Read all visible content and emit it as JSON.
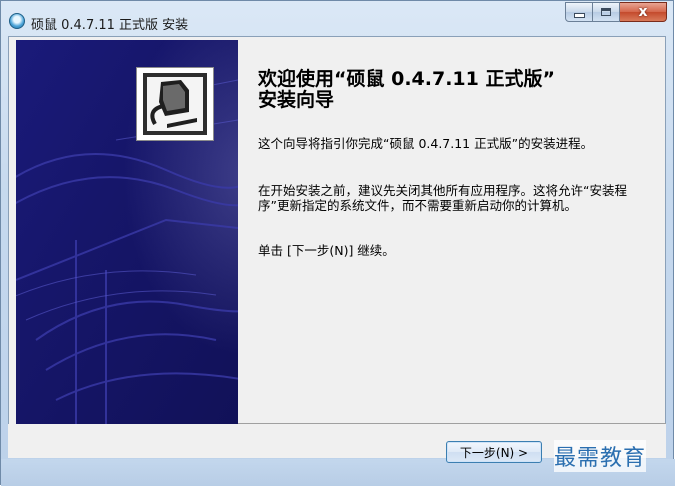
{
  "window": {
    "title": "硕鼠 0.4.7.11 正式版 安装",
    "minimize_icon": "minimize-icon",
    "maximize_icon": "maximize-icon",
    "close_icon": "close-icon",
    "close_glyph": "x"
  },
  "wizard": {
    "heading_line1": "欢迎使用“硕鼠 0.4.7.11 正式版”",
    "heading_line2": "安装向导",
    "paragraph1": "这个向导将指引你完成“硕鼠 0.4.7.11 正式版”的安装进程。",
    "paragraph2": "在开始安装之前，建议先关闭其他所有应用程序。这将允许“安装程序”更新指定的系统文件，而不需要重新启动你的计算机。",
    "paragraph3": "单击 [下一步(N)] 继续。"
  },
  "buttons": {
    "next_label": "下一步(N) >"
  },
  "watermark": {
    "text": "最需教育"
  },
  "colors": {
    "side_panel": "#16166a",
    "title_bar": "#c6d9ee",
    "client_bg": "#f0f0f0",
    "watermark": "#2b6fb0"
  }
}
